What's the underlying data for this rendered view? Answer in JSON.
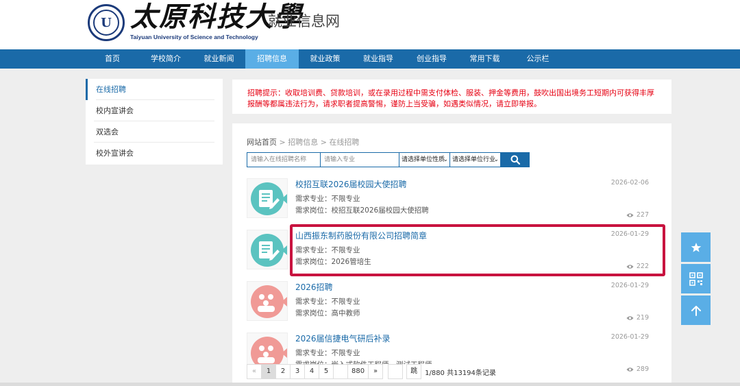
{
  "header": {
    "logo_cn": "太原科技大學",
    "logo_en": "Taiyuan University of Science and Technology",
    "site_title": "就业信息网",
    "seal_letter": "U"
  },
  "nav": {
    "items": [
      "首页",
      "学校简介",
      "就业新闻",
      "招聘信息",
      "就业政策",
      "就业指导",
      "创业指导",
      "常用下载",
      "公示栏"
    ],
    "active": "招聘信息"
  },
  "sidebar": {
    "items": [
      "在线招聘",
      "校内宣讲会",
      "双选会",
      "校外宣讲会"
    ],
    "active": "在线招聘"
  },
  "notice": "招聘提示：收取培训费、贷款培训，或在录用过程中需支付体检、服装、押金等费用，鼓吹出国出境务工短期内可获得丰厚报酬等都属违法行为，请求职者提高警惕，谨防上当受骗，如遇类似情况，请立即举报。",
  "breadcrumb": {
    "home": "网站首页",
    "sep1": " > ",
    "level1": "招聘信息",
    "sep2": " > ",
    "level2": "在线招聘"
  },
  "search": {
    "name_placeholder": "请输入在线招聘名称",
    "major_placeholder": "请输入专业",
    "nature_select": "请选择单位性质",
    "industry_select": "请选择单位行业",
    "arrow": "⌄"
  },
  "jobs": [
    {
      "title": "校招互联2026届校园大使招聘",
      "date": "2026-02-06",
      "major": "需求专业：不限专业",
      "post": "需求岗位：校招互联2026届校园大使招聘",
      "views": "227",
      "icon": "document-edit-icon"
    },
    {
      "title": "山西振东制药股份有限公司招聘简章",
      "date": "2026-01-29",
      "major": "需求专业：不限专业",
      "post": "需求岗位：2026管培生",
      "views": "222",
      "icon": "document-edit-icon"
    },
    {
      "title": "2026招聘",
      "date": "2026-01-29",
      "major": "需求专业：不限专业",
      "post": "需求岗位：高中教师",
      "views": "219",
      "icon": "group-meeting-icon"
    },
    {
      "title": "2026届信捷电气研后补录",
      "date": "2026-01-29",
      "major": "需求专业：不限专业",
      "post": "需求岗位：嵌入式软件工程师，测试工程师",
      "views": "289",
      "icon": "group-meeting-icon"
    }
  ],
  "pager": {
    "prev": "«",
    "pages": [
      "1",
      "2",
      "3",
      "4",
      "5"
    ],
    "ellipsis": "",
    "last": "880",
    "next": "»",
    "goto_value": "",
    "goto_label": "跳",
    "info": "1/880 共13194条记录"
  },
  "float_buttons": [
    "star-icon",
    "qrcode-icon",
    "arrow-up-icon"
  ],
  "colors": {
    "nav": "#1a6aa8",
    "nav_active": "#5aaee6",
    "link": "#1a6aa8",
    "notice": "#e60012",
    "highlight": "#c8133f",
    "icon_teal": "#5bc3c0",
    "icon_pink": "#f09a96"
  }
}
